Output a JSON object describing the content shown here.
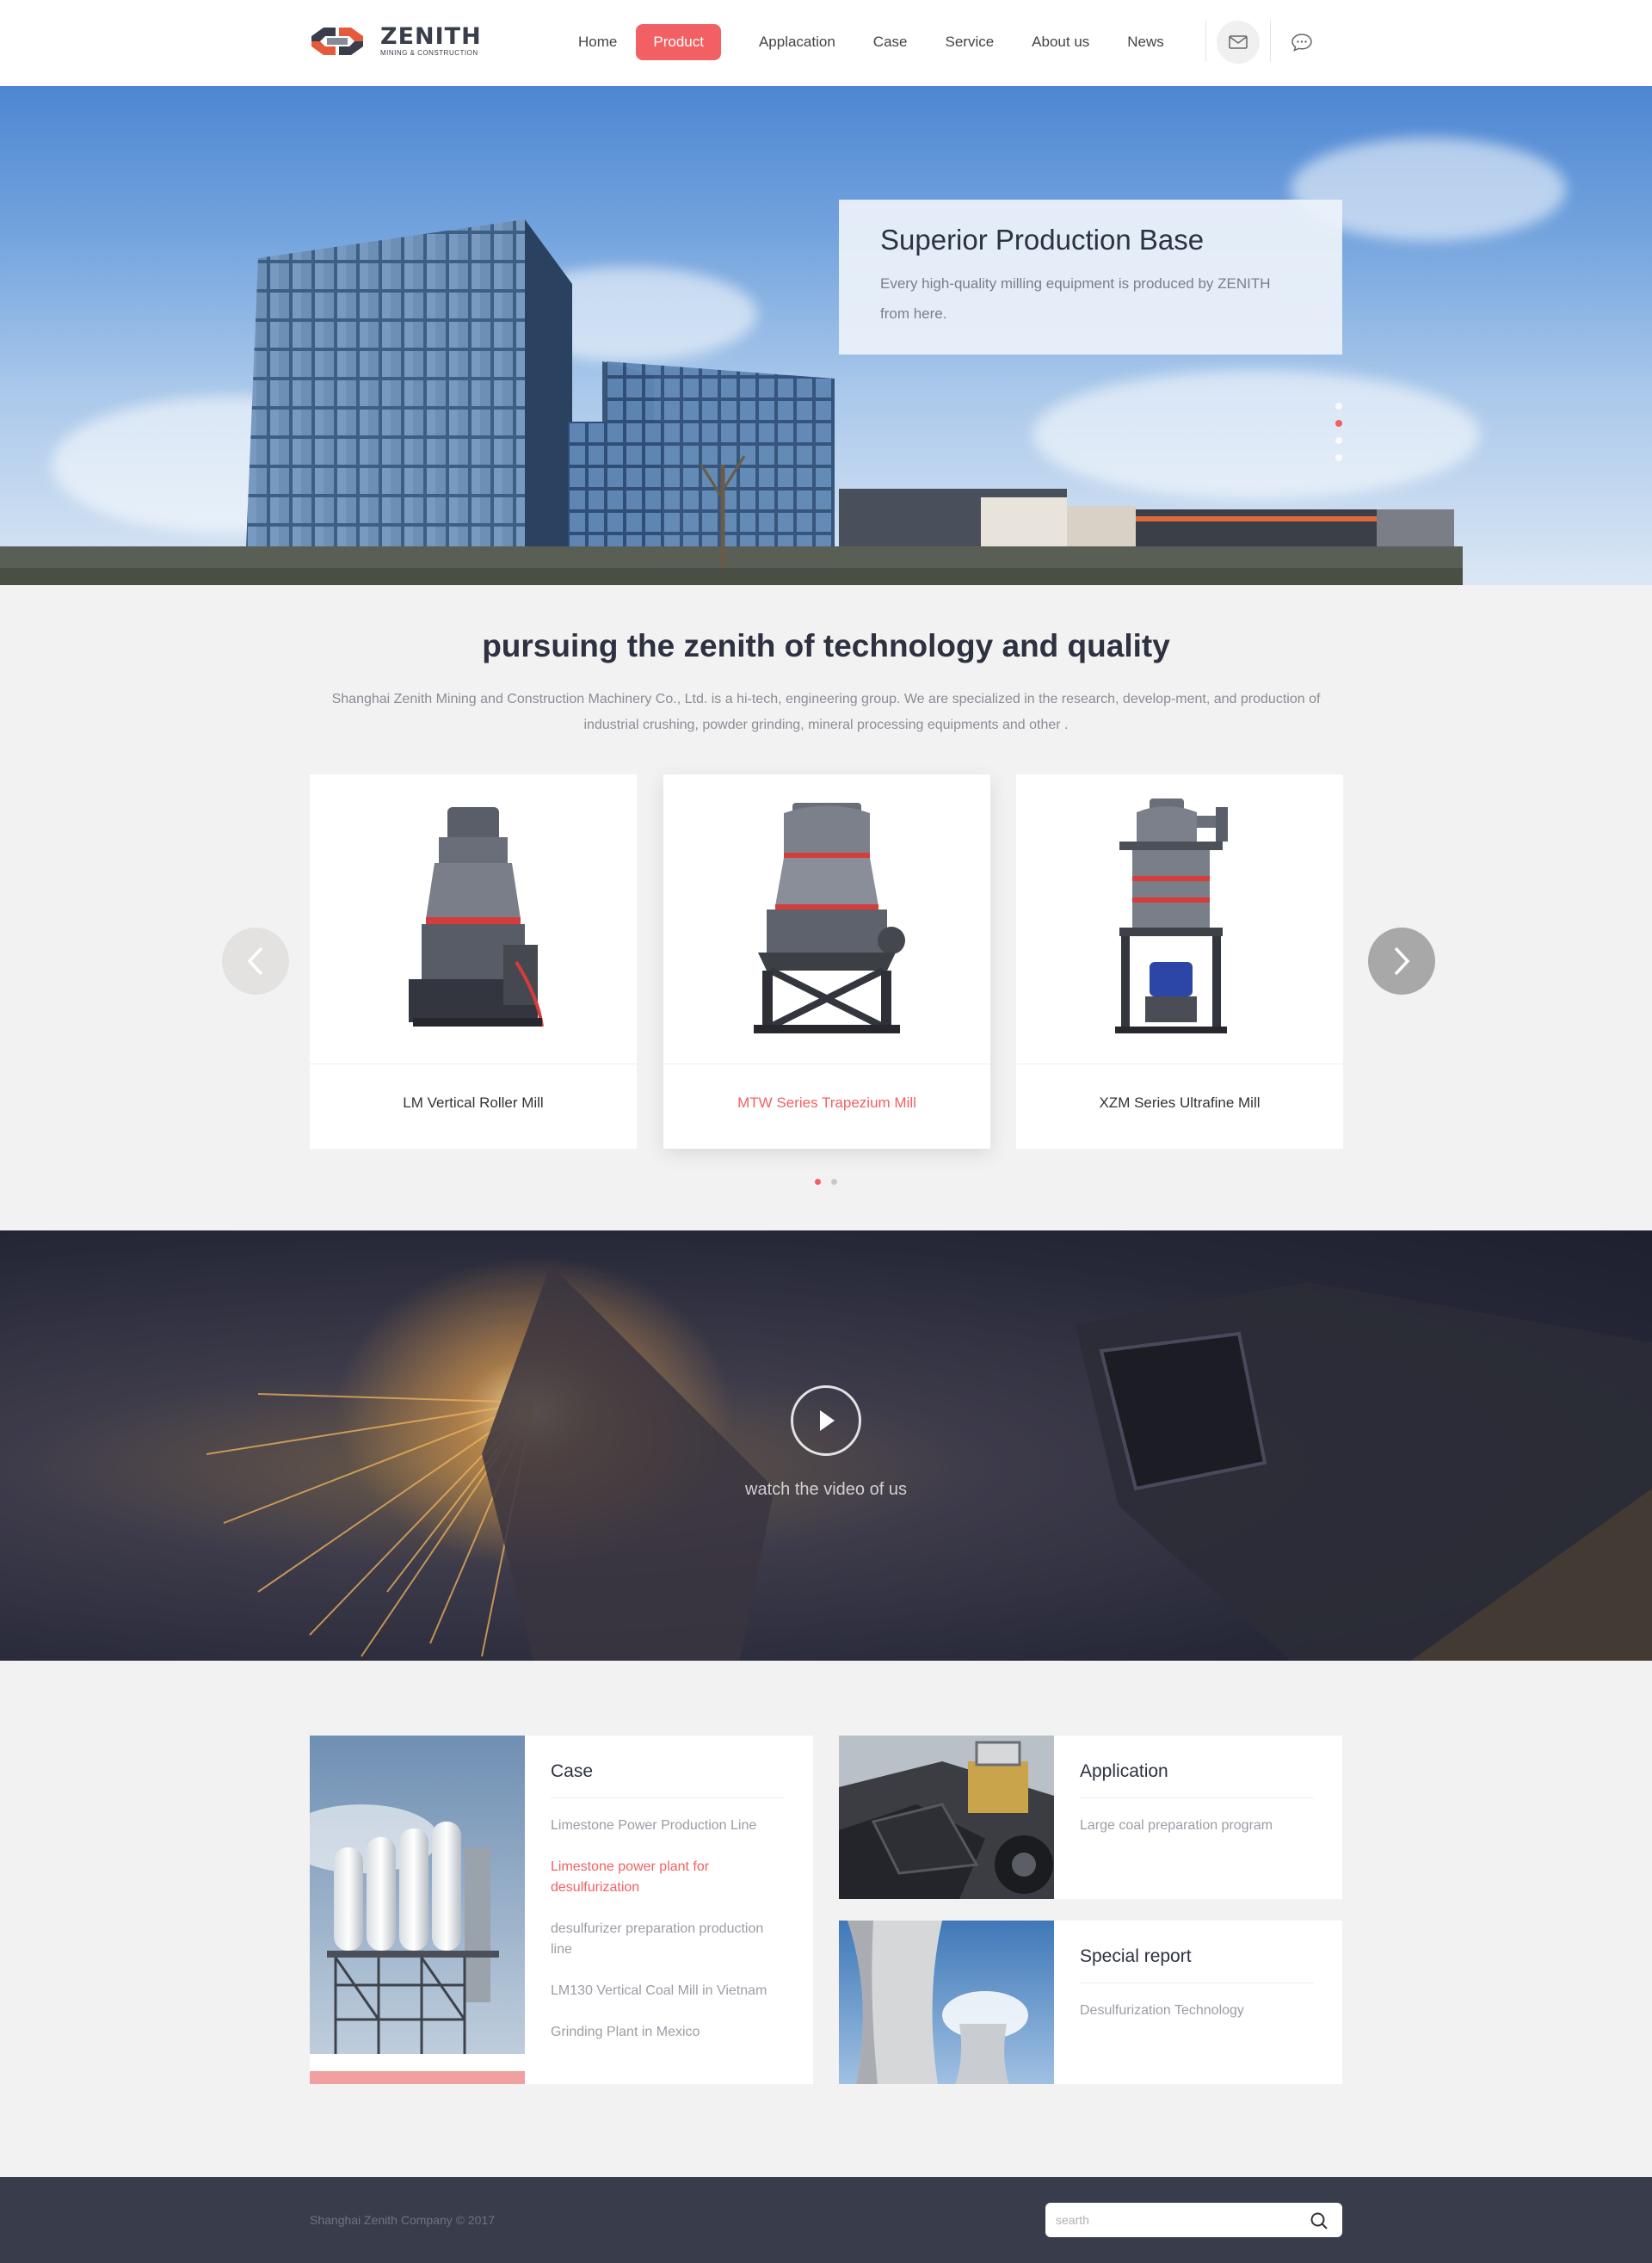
{
  "header": {
    "logo": {
      "name": "ZENITH",
      "tagline": "MINING & CONSTRUCTION"
    },
    "nav": [
      {
        "label": "Home",
        "active": false
      },
      {
        "label": "Product",
        "active": true
      },
      {
        "label": "Applacation",
        "active": false
      },
      {
        "label": "Case",
        "active": false
      },
      {
        "label": "Service",
        "active": false
      },
      {
        "label": "About us",
        "active": false
      },
      {
        "label": "News",
        "active": false
      }
    ],
    "icons": [
      "mail-icon",
      "chat-icon"
    ]
  },
  "hero": {
    "title": "Superior Production Base",
    "description": "Every high-quality milling equipment is produced by ZENITH from here.",
    "slides": 4,
    "active_slide": 2
  },
  "intro": {
    "title": "pursuing the zenith of technology and quality",
    "text": "Shanghai Zenith Mining and Construction Machinery Co., Ltd. is a hi-tech, engineering group. We are specialized in the research, develop-ment, and production of industrial crushing, powder grinding, mineral processing equipments and other ."
  },
  "products": {
    "items": [
      {
        "name": "LM Vertical Roller Mill",
        "featured": false
      },
      {
        "name": "MTW Series Trapezium Mill",
        "featured": true
      },
      {
        "name": "XZM Series Ultrafine Mill",
        "featured": false
      }
    ],
    "pages": 2,
    "active_page": 1
  },
  "video": {
    "caption": "watch the video of us"
  },
  "case": {
    "title": "Case",
    "links": [
      {
        "label": "Limestone Power Production Line",
        "highlight": false
      },
      {
        "label": "Limestone power plant for desulfurization",
        "highlight": true
      },
      {
        "label": "desulfurizer preparation production line",
        "highlight": false
      },
      {
        "label": "LM130 Vertical Coal Mill in Vietnam",
        "highlight": false
      },
      {
        "label": "Grinding Plant in Mexico",
        "highlight": false
      }
    ]
  },
  "application": {
    "title": "Application",
    "links": [
      "Large coal preparation program"
    ]
  },
  "special_report": {
    "title": "Special report",
    "links": [
      "Desulfurization Technology"
    ]
  },
  "footer": {
    "copyright": "Shanghai Zenith Company © 2017",
    "search_placeholder": "searth"
  },
  "colors": {
    "accent": "#f26063",
    "dark": "#393d4b",
    "text": "#2d3140"
  }
}
